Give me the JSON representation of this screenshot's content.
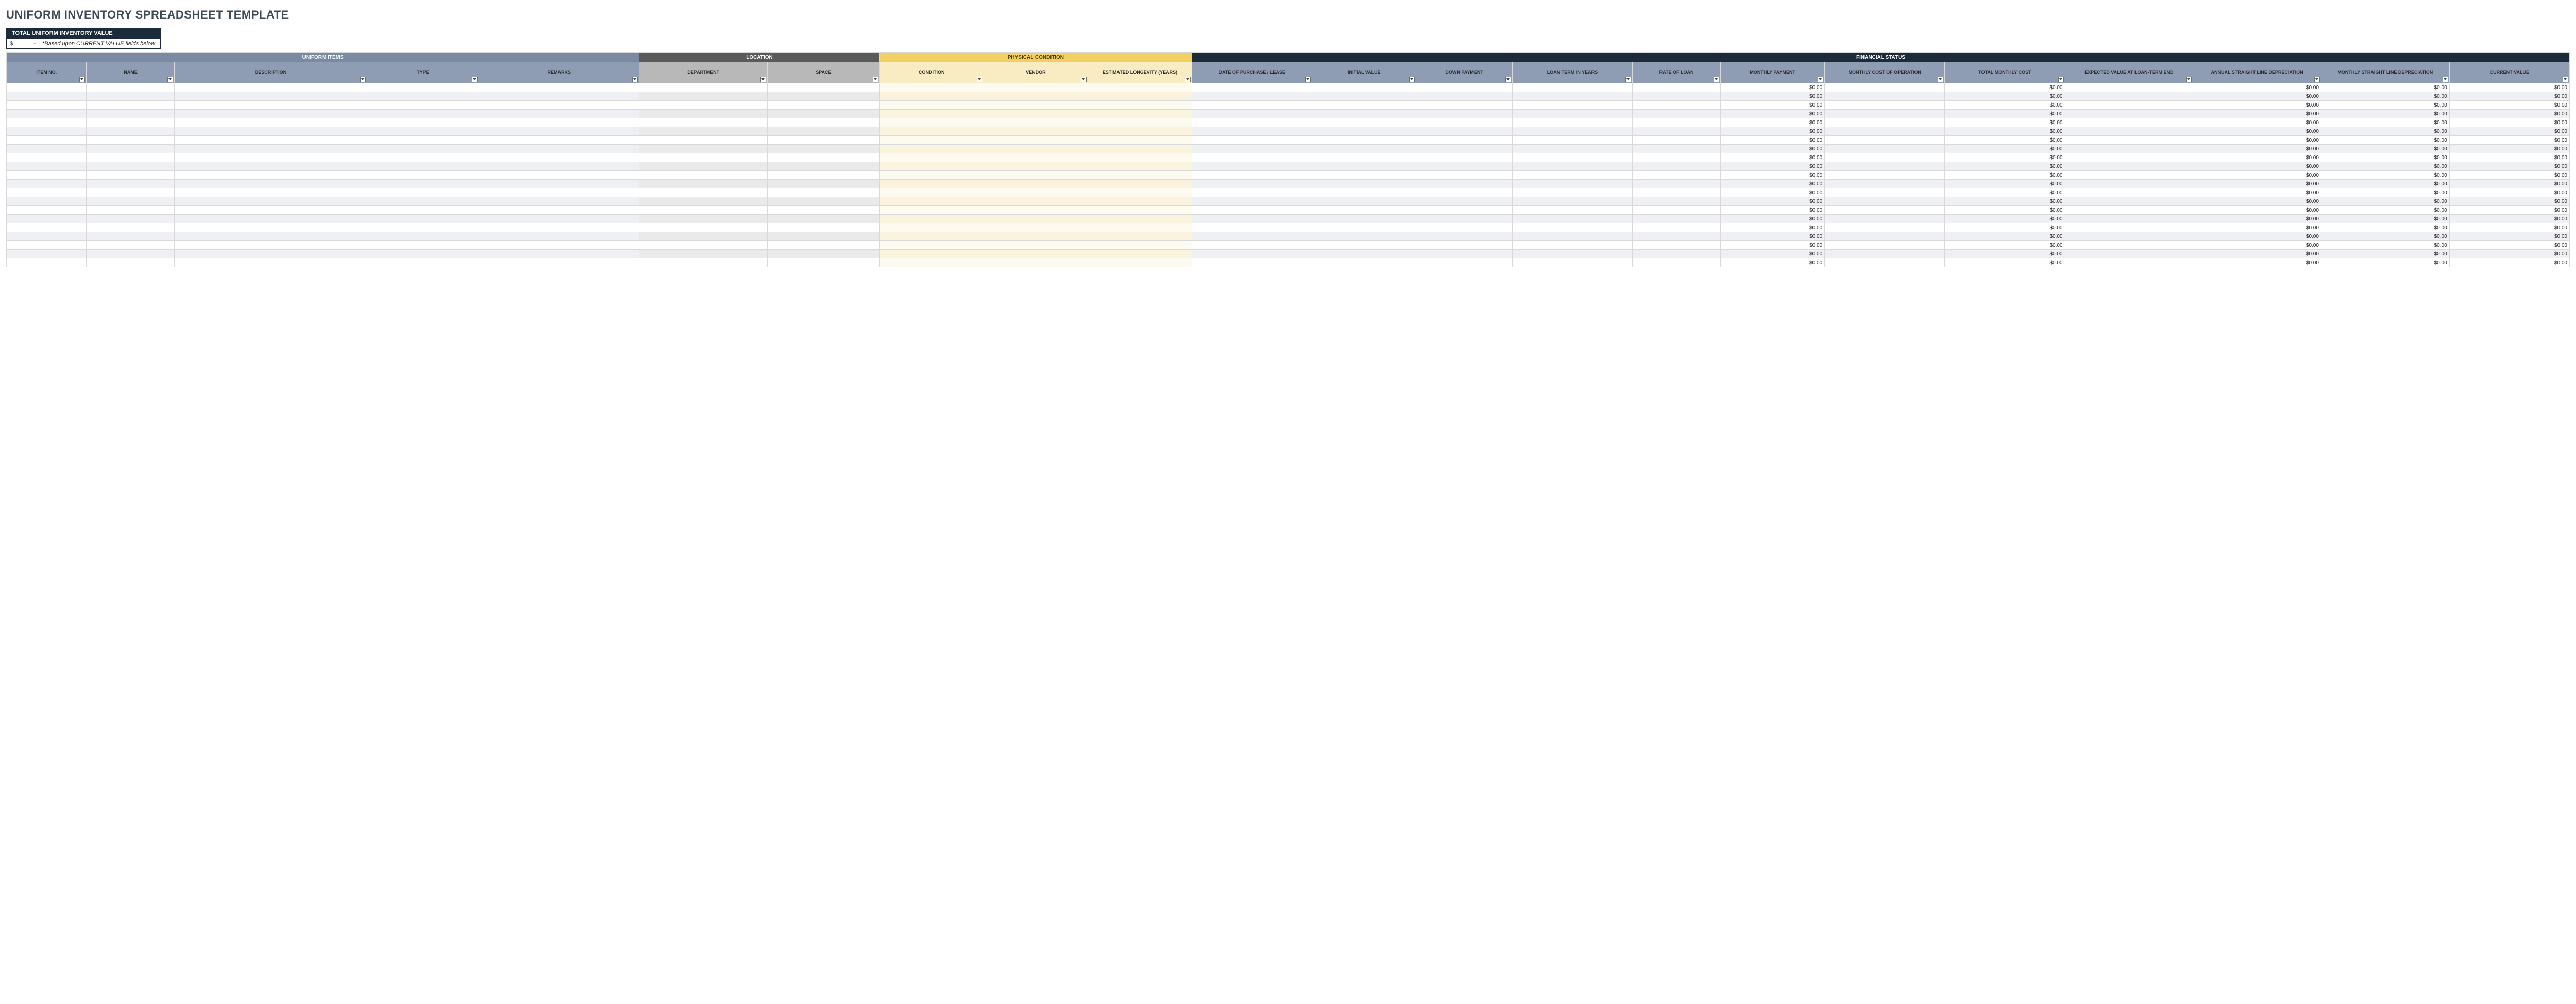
{
  "title": "UNIFORM INVENTORY SPREADSHEET TEMPLATE",
  "summary": {
    "header": "TOTAL UNIFORM INVENTORY VALUE",
    "currency": "$",
    "value": "-",
    "note": "*Based upon CURRENT VALUE fields below"
  },
  "groups": {
    "items": "UNIFORM ITEMS",
    "location": "LOCATION",
    "physical": "PHYSICAL CONDITION",
    "financial": "FINANCIAL STATUS"
  },
  "columns": [
    {
      "key": "item_no",
      "label": "ITEM NO.",
      "group": "items",
      "cls": "c-itemno"
    },
    {
      "key": "name",
      "label": "NAME",
      "group": "items",
      "cls": "c-name"
    },
    {
      "key": "description",
      "label": "DESCRIPTION",
      "group": "items",
      "cls": "c-desc"
    },
    {
      "key": "type",
      "label": "TYPE",
      "group": "items",
      "cls": "c-type"
    },
    {
      "key": "remarks",
      "label": "REMARKS",
      "group": "items",
      "cls": "c-rem"
    },
    {
      "key": "department",
      "label": "DEPARTMENT",
      "group": "location",
      "cls": "c-dept"
    },
    {
      "key": "space",
      "label": "SPACE",
      "group": "location",
      "cls": "c-space"
    },
    {
      "key": "condition",
      "label": "CONDITION",
      "group": "physical",
      "cls": "c-cond"
    },
    {
      "key": "vendor",
      "label": "VENDOR",
      "group": "physical",
      "cls": "c-vendor"
    },
    {
      "key": "est_longevity",
      "label": "ESTIMATED LONGEVITY (YEARS)",
      "group": "physical",
      "cls": "c-elong"
    },
    {
      "key": "date_purchase",
      "label": "DATE OF PURCHASE / LEASE",
      "group": "financial",
      "cls": "c-date"
    },
    {
      "key": "initial_value",
      "label": "INITIAL VALUE",
      "group": "financial",
      "cls": "c-ival"
    },
    {
      "key": "down_payment",
      "label": "DOWN PAYMENT",
      "group": "financial",
      "cls": "c-down"
    },
    {
      "key": "loan_term",
      "label": "LOAN TERM IN YEARS",
      "group": "financial",
      "cls": "c-lterm"
    },
    {
      "key": "rate_of_loan",
      "label": "RATE OF LOAN",
      "group": "financial",
      "cls": "c-rloan"
    },
    {
      "key": "monthly_payment",
      "label": "MONTHLY PAYMENT",
      "group": "financial",
      "cls": "c-mpay",
      "money": true
    },
    {
      "key": "monthly_cost_op",
      "label": "MONTHLY COST OF OPERATION",
      "group": "financial",
      "cls": "c-mcop"
    },
    {
      "key": "total_monthly_cost",
      "label": "TOTAL MONTHLY COST",
      "group": "financial",
      "cls": "c-tmc",
      "money": true
    },
    {
      "key": "expected_value_end",
      "label": "EXPECTED VALUE AT LOAN-TERM END",
      "group": "financial",
      "cls": "c-eval"
    },
    {
      "key": "annual_sl_dep",
      "label": "ANNUAL STRAIGHT LINE DEPRECIATION",
      "group": "financial",
      "cls": "c-asld",
      "money": true
    },
    {
      "key": "monthly_sl_dep",
      "label": "MONTHLY STRAIGHT LINE DEPRECIATION",
      "group": "financial",
      "cls": "c-msld",
      "money": true
    },
    {
      "key": "current_value",
      "label": "CURRENT VALUE",
      "group": "financial",
      "cls": "c-cval",
      "money": true
    }
  ],
  "row_count": 21,
  "money_default": "$0.00"
}
